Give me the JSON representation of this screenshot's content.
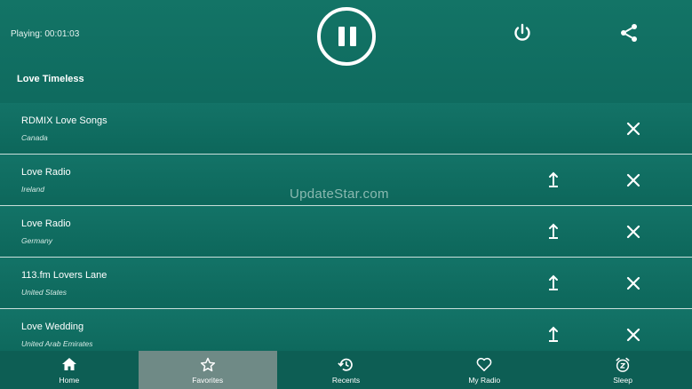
{
  "header": {
    "playing_text": "Playing: 00:01:03",
    "station_title": "Love Timeless"
  },
  "stations": [
    {
      "name": "RDMIX Love Songs",
      "country": "Canada",
      "has_move_up": false
    },
    {
      "name": "Love Radio",
      "country": "Ireland",
      "has_move_up": true
    },
    {
      "name": "Love Radio",
      "country": "Germany",
      "has_move_up": true
    },
    {
      "name": "113.fm Lovers Lane",
      "country": "United States",
      "has_move_up": true
    },
    {
      "name": "Love Wedding",
      "country": "United Arab Emirates",
      "has_move_up": true
    }
  ],
  "watermark": "UpdateStar.com",
  "nav": {
    "home": "Home",
    "favorites": "Favorites",
    "recents": "Recents",
    "my_radio": "My Radio",
    "sleep": "Sleep",
    "active": "favorites"
  },
  "colors": {
    "background": "#0f6b5f",
    "nav_background": "#0d5e54",
    "active_tab": "#6f8a86"
  }
}
